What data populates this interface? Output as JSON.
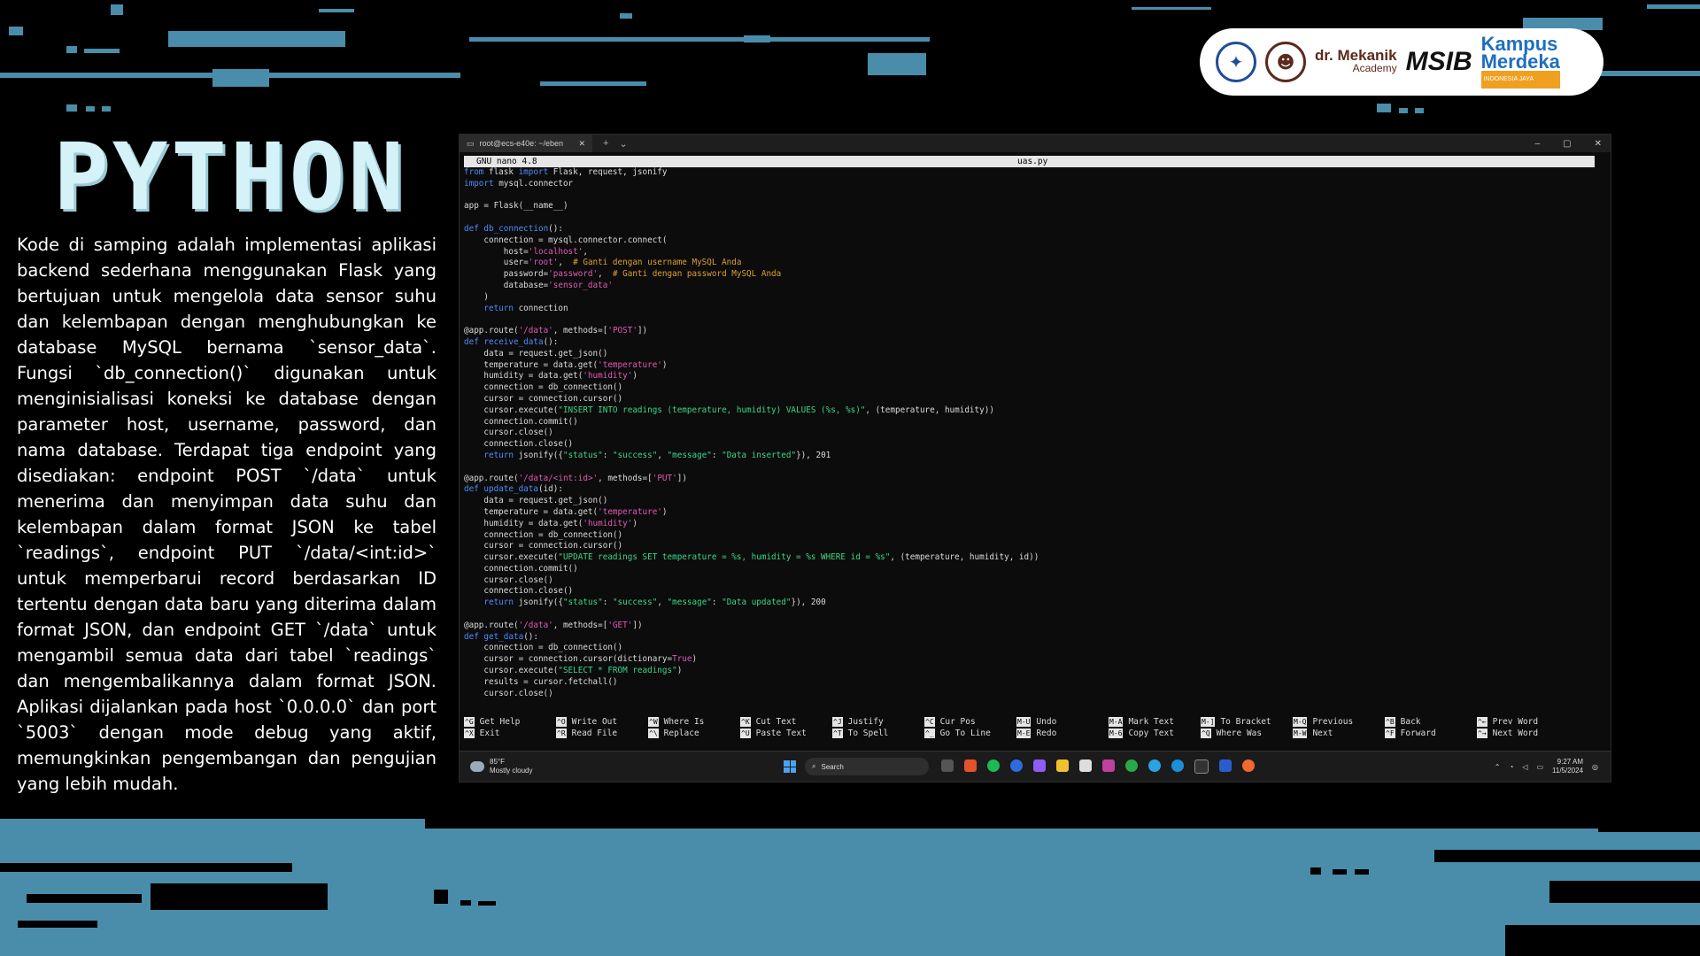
{
  "slide": {
    "title": "PYTHON",
    "description": "Kode di samping adalah implementasi aplikasi backend sederhana menggunakan Flask yang bertujuan untuk mengelola data sensor suhu dan kelembapan dengan menghubungkan ke database MySQL bernama `sensor_data`. Fungsi `db_connection()` digunakan untuk menginisialisasi koneksi ke database dengan parameter host, username, password, dan nama database. Terdapat tiga endpoint yang disediakan: endpoint POST `/data` untuk menerima dan menyimpan data suhu dan kelembapan dalam format JSON ke tabel `readings`, endpoint PUT `/data/<int:id>` untuk memperbarui record berdasarkan ID tertentu dengan data baru yang diterima dalam format JSON, dan endpoint GET `/data` untuk mengambil semua data dari tabel `readings` dan mengembalikannya dalam format JSON. Aplikasi dijalankan pada host `0.0.0.0` dan port `5003` dengan mode debug yang aktif, memungkinkan pengembangan dan pengujian yang lebih mudah."
  },
  "logos": {
    "mekanik_name": "dr. Mekanik",
    "mekanik_sub": "Academy",
    "msib": "MSIB",
    "kampus_1": "Kampus",
    "kampus_2": "Merdeka",
    "kampus_3": "INDONESIA JAYA"
  },
  "terminal": {
    "tab_title": "root@ecs-e40e: ~/eben",
    "tab_close": "✕",
    "tab_new": "+",
    "tab_dropdown": "⌄",
    "win_min": "–",
    "win_max": "▢",
    "win_close": "✕",
    "nano_version": "GNU nano 4.8",
    "filename": "uas.py",
    "shortcuts": [
      {
        "key": "^G",
        "label": "Get Help"
      },
      {
        "key": "^O",
        "label": "Write Out"
      },
      {
        "key": "^W",
        "label": "Where Is"
      },
      {
        "key": "^K",
        "label": "Cut Text"
      },
      {
        "key": "^J",
        "label": "Justify"
      },
      {
        "key": "^C",
        "label": "Cur Pos"
      },
      {
        "key": "M-U",
        "label": "Undo"
      },
      {
        "key": "M-A",
        "label": "Mark Text"
      },
      {
        "key": "M-]",
        "label": "To Bracket"
      },
      {
        "key": "M-Q",
        "label": "Previous"
      },
      {
        "key": "^B",
        "label": "Back"
      },
      {
        "key": "^←",
        "label": "Prev Word"
      },
      {
        "key": "^X",
        "label": "Exit"
      },
      {
        "key": "^R",
        "label": "Read File"
      },
      {
        "key": "^\\",
        "label": "Replace"
      },
      {
        "key": "^U",
        "label": "Paste Text"
      },
      {
        "key": "^T",
        "label": "To Spell"
      },
      {
        "key": "^_",
        "label": "Go To Line"
      },
      {
        "key": "M-E",
        "label": "Redo"
      },
      {
        "key": "M-6",
        "label": "Copy Text"
      },
      {
        "key": "^Q",
        "label": "Where Was"
      },
      {
        "key": "M-W",
        "label": "Next"
      },
      {
        "key": "^F",
        "label": "Forward"
      },
      {
        "key": "^→",
        "label": "Next Word"
      }
    ]
  },
  "taskbar": {
    "temp": "85°F",
    "weather": "Mostly cloudy",
    "search_placeholder": "Search",
    "time": "9:27 AM",
    "date": "11/5/2024"
  }
}
